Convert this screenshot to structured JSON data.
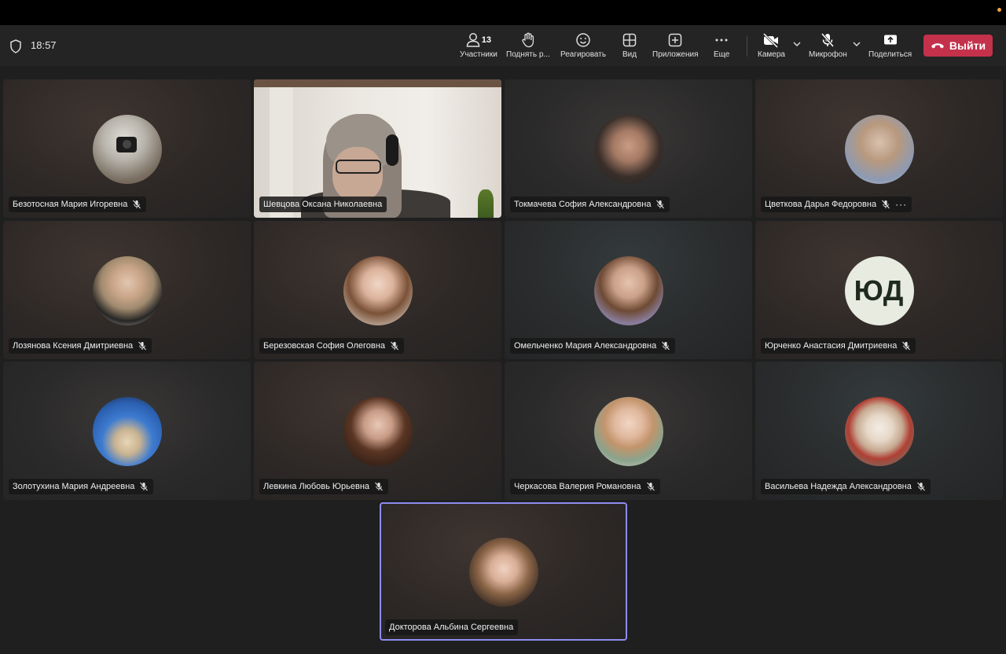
{
  "titlebar": {},
  "toolbar": {
    "time": "18:57",
    "participants": {
      "label": "Участники",
      "count": "13",
      "icon": "people-icon"
    },
    "raise_hand": {
      "label": "Поднять р...",
      "icon": "raise-hand-icon"
    },
    "react": {
      "label": "Реагировать",
      "icon": "smiley-icon"
    },
    "view": {
      "label": "Вид",
      "icon": "grid-view-icon"
    },
    "apps": {
      "label": "Приложения",
      "icon": "add-app-icon"
    },
    "more": {
      "label": "Еще",
      "icon": "more-icon"
    },
    "camera": {
      "label": "Камера",
      "icon": "camera-off-icon"
    },
    "mic": {
      "label": "Микрофон",
      "icon": "mic-off-icon"
    },
    "share": {
      "label": "Поделиться",
      "icon": "share-screen-icon"
    },
    "leave": {
      "label": "Выйти",
      "icon": "hang-up-icon",
      "color": "#c4314b"
    }
  },
  "participants": [
    {
      "name": "Безотосная Мария Игоревна",
      "muted": true,
      "avatar": "photo"
    },
    {
      "name": "Шевцова Оксана Николаевна",
      "muted": false,
      "avatar": "video"
    },
    {
      "name": "Токмачева София Александровна",
      "muted": true,
      "avatar": "photo"
    },
    {
      "name": "Цветкова Дарья Федоровна",
      "muted": true,
      "avatar": "photo",
      "more": "···"
    },
    {
      "name": "Лозянова Ксения Дмитриевна",
      "muted": true,
      "avatar": "photo"
    },
    {
      "name": "Березовская София Олеговна",
      "muted": true,
      "avatar": "photo"
    },
    {
      "name": "Омельченко Мария Александровна",
      "muted": true,
      "avatar": "photo"
    },
    {
      "name": "Юрченко Анастасия Дмитриевна",
      "muted": true,
      "avatar": "initials",
      "initials": "ЮД"
    },
    {
      "name": "Золотухина Мария Андреевна",
      "muted": true,
      "avatar": "photo"
    },
    {
      "name": "Левкина Любовь Юрьевна",
      "muted": true,
      "avatar": "photo"
    },
    {
      "name": "Черкасова Валерия Романовна",
      "muted": true,
      "avatar": "photo"
    },
    {
      "name": "Васильева Надежда Александровна",
      "muted": true,
      "avatar": "photo"
    },
    {
      "name": "Докторова Альбина Сергеевна",
      "muted": false,
      "avatar": "photo",
      "active": true
    }
  ],
  "colors": {
    "active_border": "#8e8cf0",
    "background": "#1f1f1f",
    "toolbar": "#242424"
  }
}
